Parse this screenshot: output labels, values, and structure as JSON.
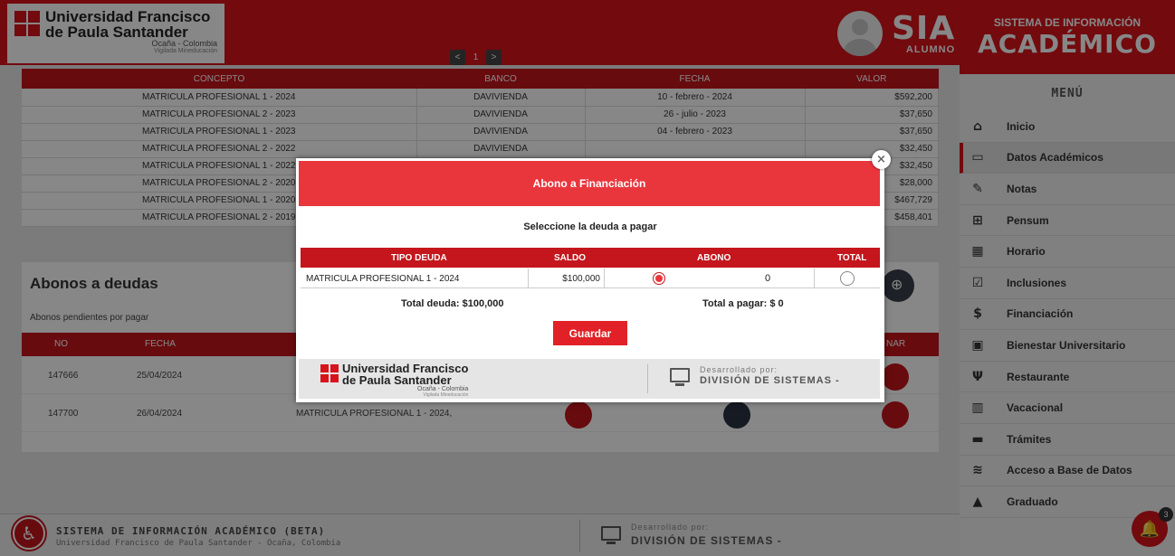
{
  "header": {
    "university_line1": "Universidad Francisco",
    "university_line2": "de Paula Santander",
    "university_city": "Ocaña - Colombia",
    "university_vigilada": "Vigilada Mineducación",
    "sia_title": "SIA",
    "sia_role": "ALUMNO"
  },
  "pager": {
    "prev": "<",
    "current": "1",
    "next": ">"
  },
  "payments_table": {
    "columns": [
      "CONCEPTO",
      "BANCO",
      "FECHA",
      "VALOR"
    ],
    "rows": [
      [
        "MATRICULA PROFESIONAL 1 - 2024",
        "DAVIVIENDA",
        "10 - febrero - 2024",
        "$592,200"
      ],
      [
        "MATRICULA PROFESIONAL 2 - 2023",
        "DAVIVIENDA",
        "26 - julio - 2023",
        "$37,650"
      ],
      [
        "MATRICULA PROFESIONAL 1 - 2023",
        "DAVIVIENDA",
        "04 - febrero - 2023",
        "$37,650"
      ],
      [
        "MATRICULA PROFESIONAL 2 - 2022",
        "DAVIVIENDA",
        "",
        "$32,450"
      ],
      [
        "MATRICULA PROFESIONAL 1 - 2022",
        "",
        "",
        "$32,450"
      ],
      [
        "MATRICULA PROFESIONAL 2 - 2020",
        "",
        "",
        "$28,000"
      ],
      [
        "MATRICULA PROFESIONAL 1 - 2020",
        "",
        "",
        "$467,729"
      ],
      [
        "MATRICULA PROFESIONAL 2 - 2019",
        "",
        "",
        "$458,401"
      ]
    ]
  },
  "abonos": {
    "title": "Abonos a deudas",
    "subtitle": "Abonos pendientes por pagar",
    "columns": {
      "no": "NO",
      "fecha": "FECHA",
      "eliminar": "NAR"
    },
    "rows": [
      {
        "no": "147666",
        "fecha": "25/04/2024",
        "concepto": ""
      },
      {
        "no": "147700",
        "fecha": "26/04/2024",
        "concepto": "MATRICULA PROFESIONAL 1 - 2024,"
      }
    ]
  },
  "footer": {
    "system": "SISTEMA DE INFORMACIÓN ACADÉMICO (BETA)",
    "university": "Universidad Francisco de Paula Santander - Ocaña, Colombia",
    "developed_by": "Desarrollado por:",
    "division": "DIVISIÓN DE SISTEMAS -"
  },
  "sidebar": {
    "top_line1": "SISTEMA DE INFORMACIÓN",
    "top_line2": "ACADÉMICO",
    "menu_title": "MENÚ",
    "items": [
      {
        "label": "Inicio",
        "icon": "home-icon",
        "glyph": "⌂"
      },
      {
        "label": "Datos Académicos",
        "icon": "card-icon",
        "glyph": "▭"
      },
      {
        "label": "Notas",
        "icon": "notes-icon",
        "glyph": "✎"
      },
      {
        "label": "Pensum",
        "icon": "sitemap-icon",
        "glyph": "⊞"
      },
      {
        "label": "Horario",
        "icon": "calendar-icon",
        "glyph": "▦"
      },
      {
        "label": "Inclusiones",
        "icon": "checkbox-icon",
        "glyph": "☑"
      },
      {
        "label": "Financiación",
        "icon": "dollar-icon",
        "glyph": "$"
      },
      {
        "label": "Bienestar Universitario",
        "icon": "briefcase-icon",
        "glyph": "▣"
      },
      {
        "label": "Restaurante",
        "icon": "utensils-icon",
        "glyph": "Ψ"
      },
      {
        "label": "Vacacional",
        "icon": "books-icon",
        "glyph": "▥"
      },
      {
        "label": "Trámites",
        "icon": "folder-icon",
        "glyph": "▬"
      },
      {
        "label": "Acceso a Base de Datos",
        "icon": "database-icon",
        "glyph": "≋"
      },
      {
        "label": "Graduado",
        "icon": "graduation-icon",
        "glyph": "▲"
      }
    ],
    "notification_count": "3"
  },
  "modal": {
    "title": "Abono a Financiación",
    "close": "×",
    "subtitle": "Seleccione la deuda a pagar",
    "columns": {
      "tipo": "TIPO DEUDA",
      "saldo": "SALDO",
      "abono": "ABONO",
      "total": "TOTAL"
    },
    "row": {
      "tipo": "MATRICULA PROFESIONAL 1 - 2024",
      "saldo": "$100,000",
      "abono_value": "0"
    },
    "total_deuda": "Total deuda: $100,000",
    "total_pagar": "Total a pagar: $ 0",
    "save_label": "Guardar",
    "footer_developed_by": "Desarrollado por:",
    "footer_division": "DIVISIÓN DE SISTEMAS -"
  },
  "accessibility_icon": "accessibility-icon",
  "colors": {
    "brand_red": "#d7141c",
    "modal_header": "#e9363d",
    "table_header": "#c4161c"
  }
}
